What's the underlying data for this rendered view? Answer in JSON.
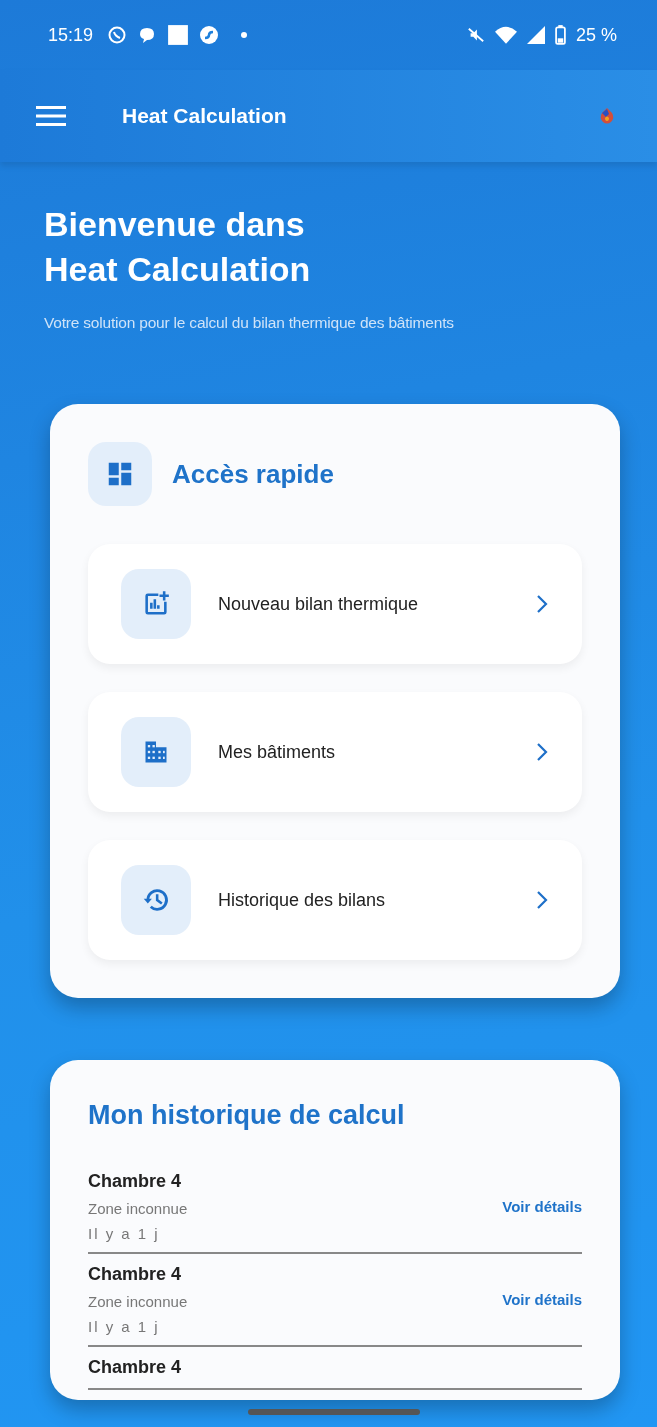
{
  "status_bar": {
    "time": "15:19",
    "battery": "25 %"
  },
  "app_bar": {
    "title": "Heat Calculation"
  },
  "welcome": {
    "title_lines": [
      "Bienvenue dans",
      "Heat Calculation"
    ],
    "subtitle": "Votre solution pour le calcul du bilan thermique des bâtiments"
  },
  "quick_access": {
    "title": "Accès rapide",
    "items": [
      {
        "kind": "new",
        "label": "Nouveau bilan thermique"
      },
      {
        "kind": "buildings",
        "label": "Mes bâtiments"
      },
      {
        "kind": "history",
        "label": "Historique des bilans"
      }
    ]
  },
  "history": {
    "title": "Mon historique de calcul",
    "rows": [
      {
        "name": "Chambre 4",
        "zone": "Zone inconnue",
        "time": "Il y a 1 j",
        "action": "Voir détails"
      },
      {
        "name": "Chambre 4",
        "zone": "Zone inconnue",
        "time": "Il y a 1 j",
        "action": "Voir détails"
      },
      {
        "name": "Chambre 4"
      }
    ]
  }
}
